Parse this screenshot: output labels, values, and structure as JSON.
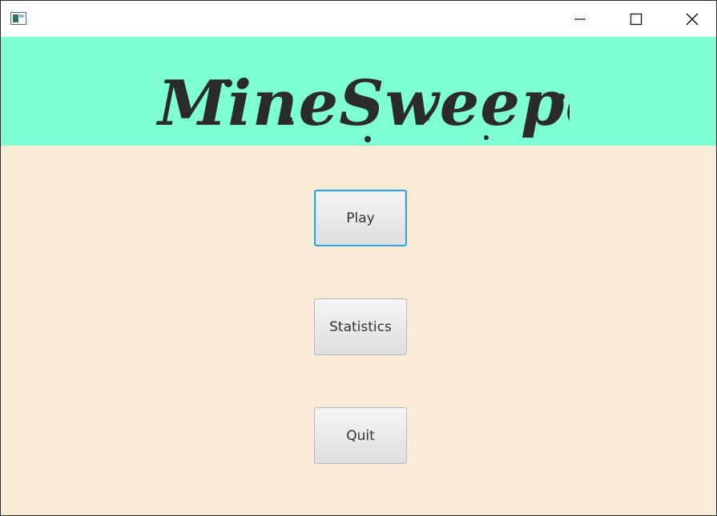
{
  "window": {
    "title": "",
    "controls": {
      "minimize_icon": "minimize-icon",
      "maximize_icon": "maximize-icon",
      "close_icon": "close-icon"
    }
  },
  "header": {
    "logo_text": "MineSweeper",
    "background_color": "#7fffd4",
    "logo_color": "#2b2b2b"
  },
  "menu": {
    "background_color": "#faebd7",
    "buttons": [
      {
        "label": "Play",
        "focused": true
      },
      {
        "label": "Statistics",
        "focused": false
      },
      {
        "label": "Quit",
        "focused": false
      }
    ],
    "focus_color": "#3aa0d8"
  }
}
